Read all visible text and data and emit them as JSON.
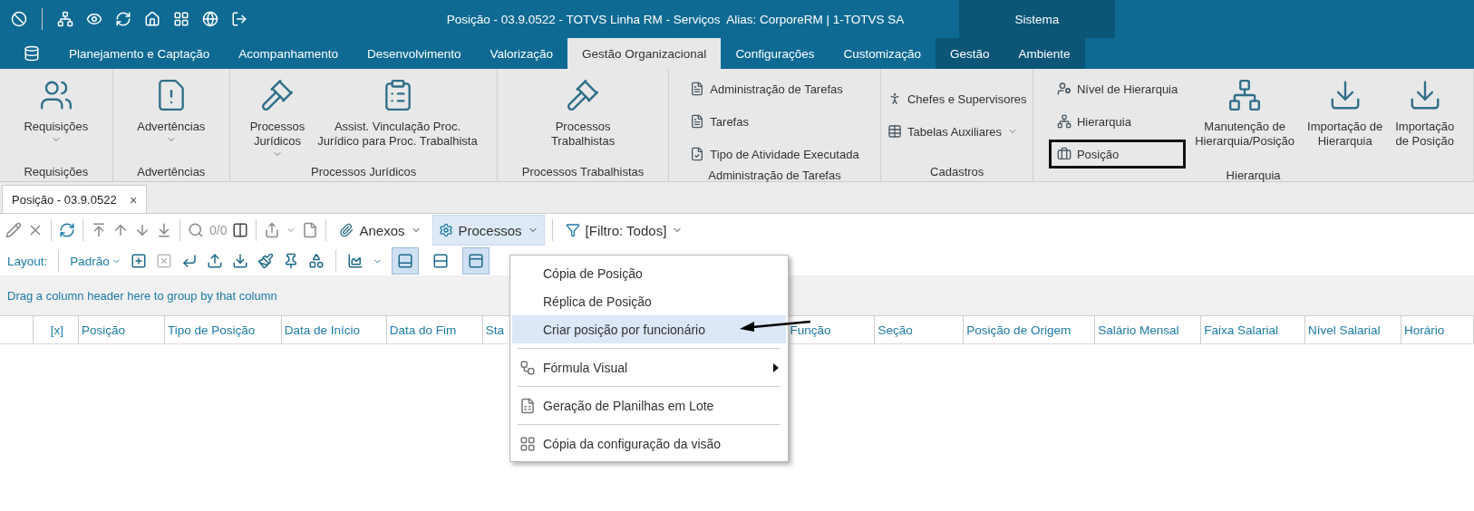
{
  "title_bar": {
    "title": "Posição - 03.9.0522 - TOTVS Linha RM - Serviços  Alias: CorporeRM | 1-TOTVS SA",
    "context_label": "Sistema"
  },
  "ribbon_tabs": [
    {
      "label": "Planejamento e Captação",
      "selected": false,
      "in_context_group": false
    },
    {
      "label": "Acompanhamento",
      "selected": false,
      "in_context_group": false
    },
    {
      "label": "Desenvolvimento",
      "selected": false,
      "in_context_group": false
    },
    {
      "label": "Valorização",
      "selected": false,
      "in_context_group": false
    },
    {
      "label": "Gestão Organizacional",
      "selected": true,
      "in_context_group": false
    },
    {
      "label": "Configurações",
      "selected": false,
      "in_context_group": false
    },
    {
      "label": "Customização",
      "selected": false,
      "in_context_group": false
    },
    {
      "label": "Gestão",
      "selected": false,
      "in_context_group": true
    },
    {
      "label": "Ambiente",
      "selected": false,
      "in_context_group": true
    }
  ],
  "ribbon_groups": [
    {
      "label": "Requisições",
      "items": [
        {
          "kind": "large",
          "lines": [
            "Requisições"
          ],
          "dropdown": true,
          "highlighted": false
        }
      ]
    },
    {
      "label": "Advertências",
      "items": [
        {
          "kind": "large",
          "lines": [
            "Advertências"
          ],
          "dropdown": true,
          "highlighted": false
        }
      ]
    },
    {
      "label": "Processos Jurídicos",
      "items": [
        {
          "kind": "large",
          "lines": [
            "Processos",
            "Jurídicos"
          ],
          "dropdown": true,
          "highlighted": false
        },
        {
          "kind": "large",
          "lines": [
            "Assist. Vinculação Proc.",
            "Jurídico para Proc. Trabalhista"
          ],
          "dropdown": false,
          "highlighted": false
        }
      ]
    },
    {
      "label": "Processos Trabalhistas",
      "items": [
        {
          "kind": "large",
          "lines": [
            "Processos",
            "Trabalhistas"
          ],
          "dropdown": false,
          "highlighted": false
        }
      ]
    },
    {
      "label": "Administração de Tarefas",
      "items": [
        {
          "kind": "small",
          "lines": [
            "Administração de Tarefas"
          ],
          "dropdown": false,
          "highlighted": false
        },
        {
          "kind": "small",
          "lines": [
            "Tarefas"
          ],
          "dropdown": false,
          "highlighted": false
        },
        {
          "kind": "small",
          "lines": [
            "Tipo de Atividade Executada"
          ],
          "dropdown": false,
          "highlighted": false
        }
      ]
    },
    {
      "label": "Cadastros",
      "items": [
        {
          "kind": "small",
          "lines": [
            "Chefes e Supervisores"
          ],
          "dropdown": false,
          "highlighted": false
        },
        {
          "kind": "small",
          "lines": [
            "Tabelas Auxiliares"
          ],
          "dropdown": true,
          "highlighted": false
        }
      ]
    },
    {
      "label": "Hierarquia",
      "items": [
        {
          "kind": "small",
          "lines": [
            "Nível de Hierarquia"
          ],
          "dropdown": false,
          "highlighted": false
        },
        {
          "kind": "small",
          "lines": [
            "Hierarquia"
          ],
          "dropdown": false,
          "highlighted": false
        },
        {
          "kind": "small",
          "lines": [
            "Posição"
          ],
          "dropdown": false,
          "highlighted": true
        },
        {
          "kind": "large",
          "lines": [
            "Manutenção de",
            "Hierarquia/Posição"
          ],
          "dropdown": false,
          "highlighted": false
        },
        {
          "kind": "large",
          "lines": [
            "Importação de",
            "Hierarquia"
          ],
          "dropdown": false,
          "highlighted": false
        },
        {
          "kind": "large",
          "lines": [
            "Importação",
            "de Posição"
          ],
          "dropdown": false,
          "highlighted": false
        }
      ]
    }
  ],
  "document_tab": {
    "label": "Posição - 03.9.0522",
    "close": "×"
  },
  "toolbar": {
    "record_count": "0/0",
    "attachments": "Anexos",
    "processes": "Processos",
    "processes_open": true,
    "filter": "[Filtro: Todos]"
  },
  "layout_bar": {
    "label": "Layout:",
    "preset": "Padrão",
    "view_buttons": [
      {
        "pressed": true
      },
      {
        "pressed": false
      },
      {
        "pressed": true
      }
    ]
  },
  "group_panel": {
    "hint": "Drag a column header here to group by that column"
  },
  "grid": {
    "columns": [
      "[x]",
      "Posição",
      "Tipo de Posição",
      "Data de Início",
      "Data do Fim",
      "Sta",
      "Função",
      "Seção",
      "Posição de Origem",
      "Salário Mensal",
      "Faixa Salarial",
      "Nível Salarial",
      "Horário"
    ]
  },
  "process_menu": [
    {
      "label": "Cópia de Posição",
      "selected": false,
      "separator_before": false,
      "submenu": false
    },
    {
      "label": "Réplica de Posição",
      "selected": false,
      "separator_before": false,
      "submenu": false
    },
    {
      "label": "Criar posição por funcionário",
      "selected": true,
      "separator_before": false,
      "submenu": false
    },
    {
      "label": "Fórmula Visual",
      "selected": false,
      "separator_before": true,
      "submenu": true
    },
    {
      "label": "Geração de Planilhas em Lote",
      "selected": false,
      "separator_before": true,
      "submenu": false
    },
    {
      "label": "Cópia da configuração da visão",
      "selected": false,
      "separator_before": true,
      "submenu": false
    }
  ]
}
